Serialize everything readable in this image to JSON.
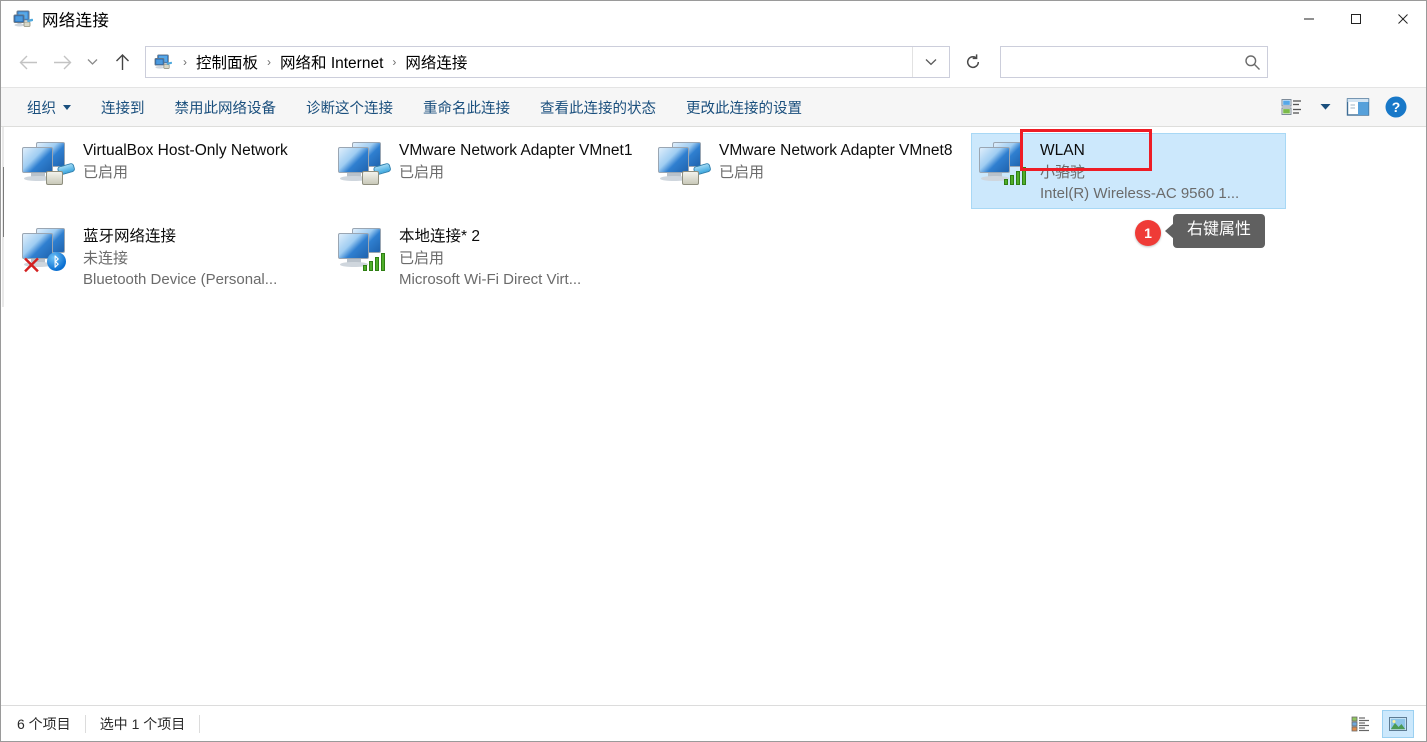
{
  "window": {
    "title": "网络连接",
    "title_icon": "network-connections-icon",
    "minimize_label": "—",
    "maximize_label": "□",
    "close_label": "✕"
  },
  "address_bar": {
    "back_icon": "arrow-left-icon",
    "forward_icon": "arrow-right-icon",
    "recent_icon": "chevron-down-icon",
    "up_icon": "arrow-up-icon",
    "path_icon": "network-connections-icon",
    "crumbs": [
      "控制面板",
      "网络和 Internet",
      "网络连接"
    ],
    "separator": "›",
    "dropdown_icon": "chevron-down-icon",
    "refresh_icon": "refresh-icon",
    "search_value": "",
    "search_placeholder": "",
    "search_icon": "search-icon"
  },
  "command_bar": {
    "items": [
      {
        "label": "组织",
        "has_caret": true
      },
      {
        "label": "连接到",
        "has_caret": false
      },
      {
        "label": "禁用此网络设备",
        "has_caret": false
      },
      {
        "label": "诊断这个连接",
        "has_caret": false
      },
      {
        "label": "重命名此连接",
        "has_caret": false
      },
      {
        "label": "查看此连接的状态",
        "has_caret": false
      },
      {
        "label": "更改此连接的设置",
        "has_caret": false
      }
    ],
    "right_icons": [
      {
        "name": "change-view-icon"
      },
      {
        "name": "chevron-down-icon"
      },
      {
        "name": "preview-pane-icon"
      },
      {
        "name": "help-icon",
        "glyph": "?"
      }
    ]
  },
  "connections": [
    {
      "name": "VirtualBox Host-Only Network",
      "status": "已启用",
      "device": "",
      "icon": "network-adapter-icon",
      "badge": "rj45",
      "selected": false,
      "disconnected": false
    },
    {
      "name": "VMware Network Adapter VMnet1",
      "status": "已启用",
      "device": "",
      "icon": "network-adapter-icon",
      "badge": "rj45",
      "selected": false,
      "disconnected": false
    },
    {
      "name": "VMware Network Adapter VMnet8",
      "status": "已启用",
      "device": "",
      "icon": "network-adapter-icon",
      "badge": "rj45",
      "selected": false,
      "disconnected": false
    },
    {
      "name": "WLAN",
      "status": "小骆驼",
      "device": "Intel(R) Wireless-AC 9560 1...",
      "icon": "wireless-adapter-icon",
      "badge": "signal-bars",
      "selected": true,
      "disconnected": false
    },
    {
      "name": "蓝牙网络连接",
      "status": "未连接",
      "device": "Bluetooth Device (Personal...",
      "icon": "bluetooth-adapter-icon",
      "badge": "bluetooth",
      "selected": false,
      "disconnected": true
    },
    {
      "name": "本地连接* 2",
      "status": "已启用",
      "device": "Microsoft Wi-Fi Direct Virt...",
      "icon": "wireless-adapter-icon",
      "badge": "signal-bars",
      "selected": false,
      "disconnected": false
    }
  ],
  "annotation": {
    "badge_number": "1",
    "tooltip_text": "右键属性",
    "highlight_color": "#ee1c25",
    "badge_color": "#ef3b37",
    "tooltip_bg": "#606060"
  },
  "status_bar": {
    "item_count": "6 个项目",
    "selection": "选中 1 个项目",
    "view_details_icon": "details-view-icon",
    "view_large_icons_icon": "large-icons-view-icon"
  },
  "colors": {
    "selection_bg": "#cce8fc",
    "command_text": "#1a4f7d",
    "toolbar_bg": "#f6f6f6"
  }
}
